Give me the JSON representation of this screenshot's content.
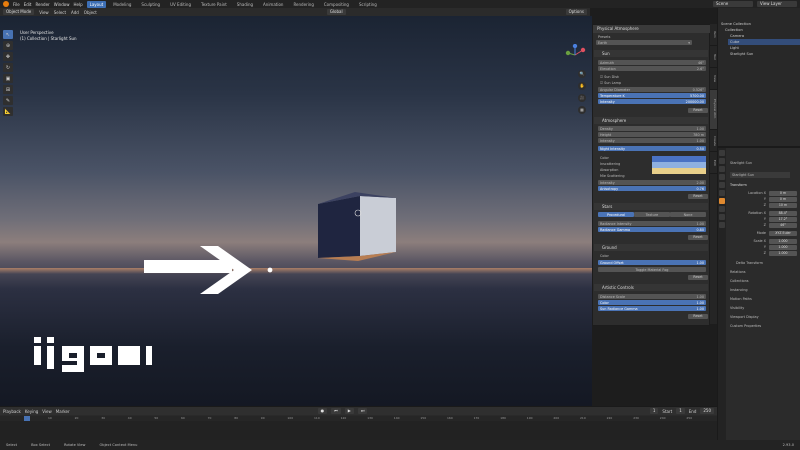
{
  "topbar": {
    "menus": [
      "File",
      "Edit",
      "Render",
      "Window",
      "Help"
    ],
    "workspaces": [
      "Layout",
      "Modeling",
      "Sculpting",
      "UV Editing",
      "Texture Paint",
      "Shading",
      "Animation",
      "Rendering",
      "Compositing",
      "Scripting"
    ],
    "active_workspace": "Layout",
    "scene": "Scene",
    "view_layer": "View Layer"
  },
  "header": {
    "mode": "Object Mode",
    "menus": [
      "View",
      "Select",
      "Add",
      "Object"
    ],
    "transform": "Global",
    "options": "Options"
  },
  "viewport": {
    "view_name": "User Perspective",
    "collection_info": "(1) Collection | Starlight Sun"
  },
  "sky_panel": {
    "title": "Physical Atmosphere",
    "presets_label": "Presets",
    "preset_value": "Earth",
    "sun": {
      "title": "Sun",
      "rows": [
        {
          "label": "Azimuth",
          "value": "46°"
        },
        {
          "label": "Elevation",
          "value": "2.6°"
        }
      ],
      "sun_disk": "Sun Disk",
      "sun_lamp": "Sun Lamp",
      "rows2": [
        {
          "label": "Angular Diameter",
          "value": "0.526°"
        },
        {
          "label": "Temperature K",
          "value": "5700.00"
        },
        {
          "label": "Intensity",
          "value": "200000.00"
        }
      ],
      "reset": "Reset"
    },
    "atmosphere": {
      "title": "Atmosphere",
      "rows": [
        {
          "label": "Density",
          "value": "1.00"
        },
        {
          "label": "Height",
          "value": "780 m"
        },
        {
          "label": "Intensity",
          "value": "1.00"
        },
        {
          "label": "Night Intensity",
          "value": "0.50"
        }
      ],
      "color_label": "Color",
      "colors": [
        {
          "label": "Inscattering",
          "color": "#4a72c4"
        },
        {
          "label": "Absorption",
          "color": "#8fb0e0"
        },
        {
          "label": "Mie Scattering",
          "color": "#e8cf8a"
        }
      ],
      "rows2": [
        {
          "label": "Intensity",
          "value": "2.00"
        },
        {
          "label": "Anisotropy",
          "value": "0.76"
        }
      ],
      "reset": "Reset"
    },
    "stars": {
      "title": "Stars",
      "tabs": [
        "Procedural",
        "Texture",
        "None"
      ],
      "rows": [
        {
          "label": "Radiance Intensity",
          "value": "1.00"
        },
        {
          "label": "Radiance Gamma",
          "value": "0.80"
        }
      ],
      "reset": "Reset"
    },
    "ground": {
      "title": "Ground",
      "color_label": "Color",
      "rows": [
        {
          "label": "Ground Offset",
          "value": "1.00"
        }
      ],
      "toggle": "Toggle Material Fog",
      "reset": "Reset"
    },
    "artistic": {
      "title": "Artistic Controls",
      "rows": [
        {
          "label": "Distance Scale",
          "value": "1.00"
        },
        {
          "label": "Color",
          "value": "1.00"
        },
        {
          "label": "Sun Radiance Gamma",
          "value": "1.00"
        }
      ],
      "reset": "Reset"
    }
  },
  "side_tabs": [
    "Item",
    "Tool",
    "View",
    "Physical Atm.",
    "Create",
    "Edit"
  ],
  "outliner": {
    "title": "Scene Collection",
    "items": [
      {
        "label": "Collection",
        "indent": 1
      },
      {
        "label": "Camera",
        "indent": 2
      },
      {
        "label": "Cube",
        "indent": 2,
        "selected": true
      },
      {
        "label": "Light",
        "indent": 2
      },
      {
        "label": "Starlight Sun",
        "indent": 2
      }
    ]
  },
  "properties": {
    "object_name": "Starlight Sun",
    "data_name": "Starlight Sun",
    "transform_title": "Transform",
    "rows": [
      {
        "label": "Location X",
        "value": "0 m"
      },
      {
        "label": "Y",
        "value": "0 m"
      },
      {
        "label": "Z",
        "value": "10 m"
      },
      {
        "label": "Rotation X",
        "value": "88.4°"
      },
      {
        "label": "Y",
        "value": "17.2°"
      },
      {
        "label": "Z",
        "value": "46°"
      },
      {
        "label": "Mode",
        "value": "XYZ Euler"
      },
      {
        "label": "Scale X",
        "value": "1.000"
      },
      {
        "label": "Y",
        "value": "1.000"
      },
      {
        "label": "Z",
        "value": "1.000"
      }
    ],
    "subsections": [
      "Delta Transform",
      "Relations",
      "Collections",
      "Instancing",
      "Motion Paths",
      "Visibility",
      "Viewport Display",
      "Custom Properties"
    ]
  },
  "timeline": {
    "menus": [
      "Playback",
      "Keying",
      "View",
      "Marker"
    ],
    "current_frame": "1",
    "start_label": "Start",
    "start": "1",
    "end_label": "End",
    "end": "250",
    "ticks": [
      "10",
      "20",
      "30",
      "40",
      "50",
      "60",
      "70",
      "80",
      "90",
      "100",
      "110",
      "120",
      "130",
      "140",
      "150",
      "160",
      "170",
      "180",
      "190",
      "200",
      "210",
      "220",
      "230",
      "240",
      "250"
    ]
  },
  "statusbar": {
    "items": [
      "Select",
      "Box Select",
      "Rotate View",
      "Object Context Menu"
    ],
    "version": "2.93.0"
  },
  "overlay": {
    "logo_text": "ijigen"
  }
}
